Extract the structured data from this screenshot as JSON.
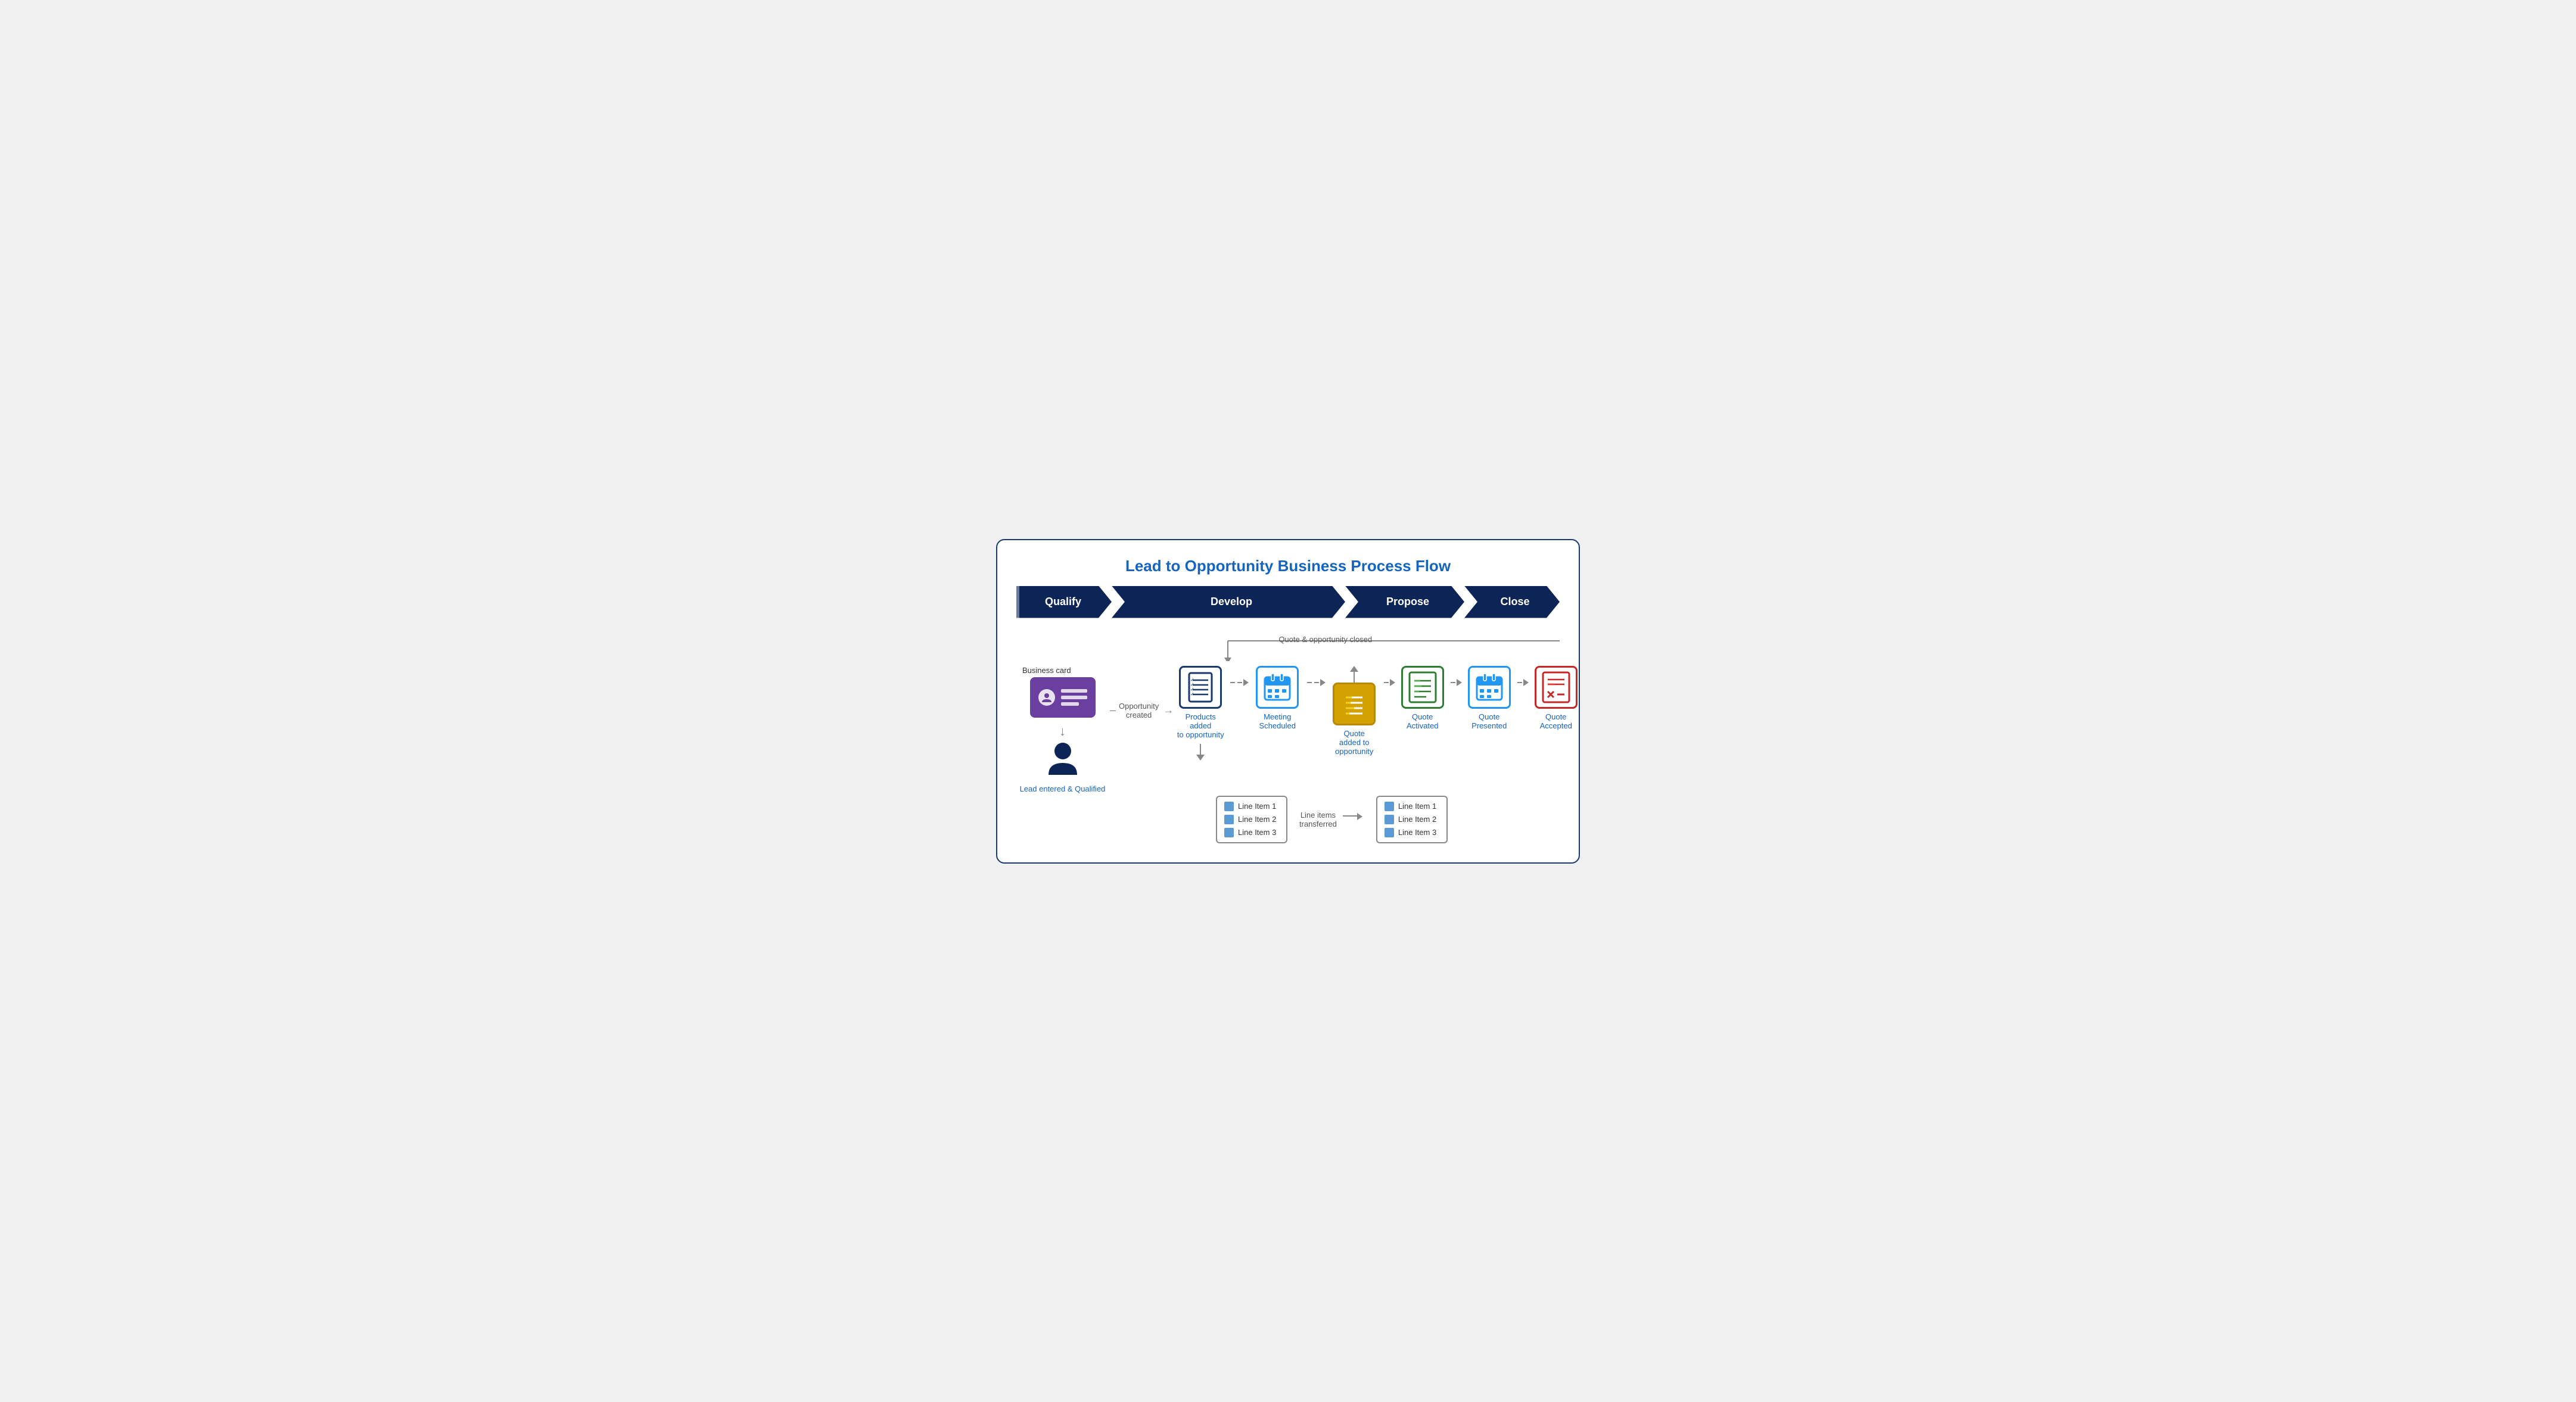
{
  "title": "Lead to Opportunity Business Process Flow",
  "phases": [
    {
      "id": "qualify",
      "label": "Qualify"
    },
    {
      "id": "develop",
      "label": "Develop"
    },
    {
      "id": "propose",
      "label": "Propose"
    },
    {
      "id": "close",
      "label": "Close"
    }
  ],
  "bizCard": {
    "label": "Business card"
  },
  "lead": {
    "label": "Lead entered\n& Qualified"
  },
  "opportunityCreated": {
    "label": "Opportunity\ncreated"
  },
  "nodes": [
    {
      "id": "products",
      "label": "Products added\nto opportunity",
      "iconType": "checklist-blue"
    },
    {
      "id": "meeting",
      "label": "Meeting\nScheduled",
      "iconType": "calendar-blue"
    },
    {
      "id": "quote",
      "label": "Quote\nadded to\nopportunity",
      "iconType": "quote-gold"
    },
    {
      "id": "activated",
      "label": "Quote\nActivated",
      "iconType": "quote-green"
    },
    {
      "id": "presented",
      "label": "Quote\nPresented",
      "iconType": "calendar-blue2"
    },
    {
      "id": "accepted",
      "label": "Quote\nAccepted",
      "iconType": "quote-red"
    }
  ],
  "feedback": {
    "label": "Quote & opportunity closed"
  },
  "lineItems": {
    "opp": [
      {
        "label": "Line Item 1"
      },
      {
        "label": "Line Item 2"
      },
      {
        "label": "Line Item 3"
      }
    ],
    "quote": [
      {
        "label": "Line Item 1"
      },
      {
        "label": "Line Item 2"
      },
      {
        "label": "Line Item 3"
      }
    ],
    "transferLabel": "Line items\ntransferred"
  }
}
